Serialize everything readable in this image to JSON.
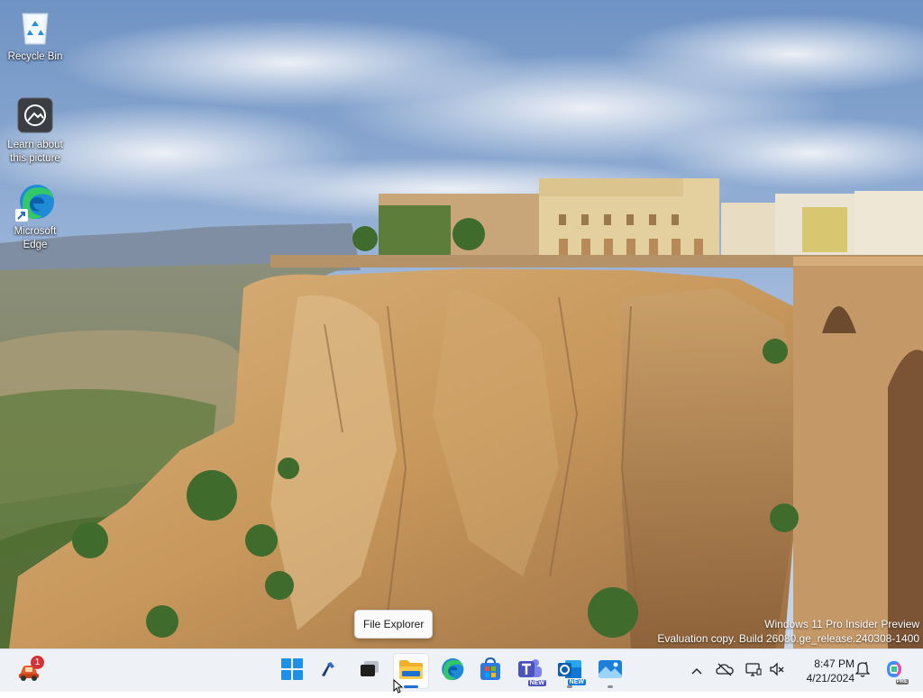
{
  "desktop": {
    "icons": [
      {
        "label": "Recycle Bin",
        "icon": "recycle-bin-icon"
      },
      {
        "label": "Learn about this picture",
        "icon": "camera-icon"
      },
      {
        "label": "Microsoft Edge",
        "icon": "edge-icon"
      }
    ]
  },
  "watermark": {
    "line1": "Windows 11 Pro Insider Preview",
    "line2": "Evaluation copy. Build 26080.ge_release.240308-1400"
  },
  "tooltip": {
    "text": "File Explorer"
  },
  "taskbar": {
    "widgets_badge": "1",
    "apps": [
      {
        "name": "Start",
        "icon": "windows-start-icon"
      },
      {
        "name": "Search",
        "icon": "search-icon"
      },
      {
        "name": "Task View",
        "icon": "task-view-icon"
      },
      {
        "name": "File Explorer",
        "icon": "folder-icon",
        "active": true
      },
      {
        "name": "Microsoft Edge",
        "icon": "edge-icon"
      },
      {
        "name": "Microsoft Store",
        "icon": "store-icon"
      },
      {
        "name": "Microsoft Teams",
        "icon": "teams-icon",
        "badge": "NEW"
      },
      {
        "name": "Outlook",
        "icon": "outlook-icon",
        "badge": "NEW",
        "running": true
      },
      {
        "name": "Photos",
        "icon": "photos-icon",
        "running": true
      }
    ],
    "tray": {
      "icons": [
        "chevron-up-icon",
        "onedrive-offline-icon",
        "network-icon",
        "volume-muted-icon"
      ],
      "time": "8:47 PM",
      "date": "4/21/2024",
      "notification_icon": "bell-icon",
      "copilot_badge": "PRE"
    }
  }
}
